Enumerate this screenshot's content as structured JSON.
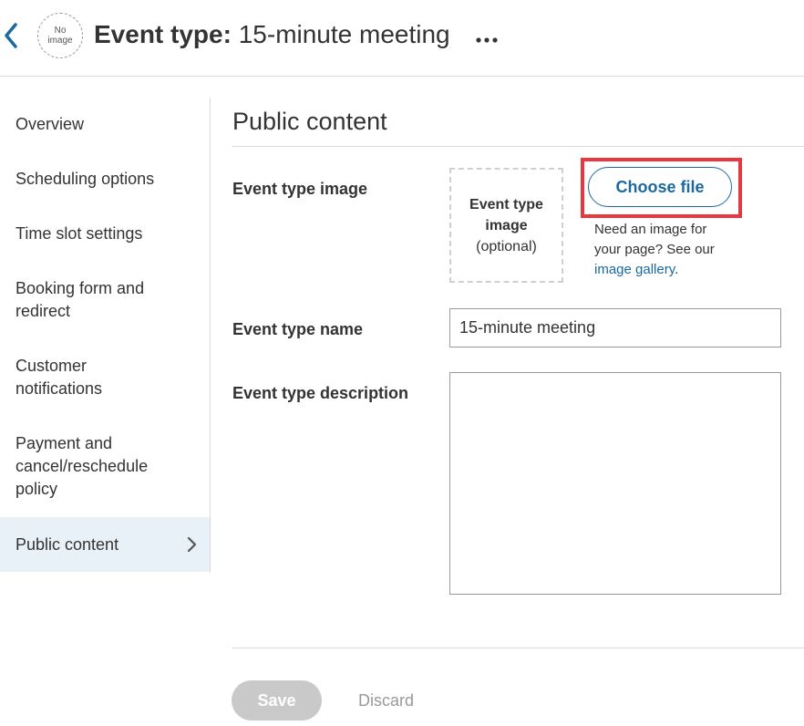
{
  "header": {
    "avatar_text_line1": "No",
    "avatar_text_line2": "image",
    "title_label": "Event type:",
    "title_value": "15-minute meeting"
  },
  "sidebar": {
    "items": [
      {
        "label": "Overview"
      },
      {
        "label": "Scheduling options"
      },
      {
        "label": "Time slot settings"
      },
      {
        "label": "Booking form and redirect"
      },
      {
        "label": "Customer notifications"
      },
      {
        "label": "Payment and cancel/reschedule policy"
      },
      {
        "label": "Public content",
        "active": true
      }
    ]
  },
  "main": {
    "section_title": "Public content",
    "image_field": {
      "label": "Event type image",
      "placeholder_line1": "Event type",
      "placeholder_line2": "image",
      "placeholder_line3": "(optional)",
      "choose_button": "Choose file",
      "help_text": "Need an image for your page? See our ",
      "help_link": "image gallery",
      "help_end": "."
    },
    "name_field": {
      "label": "Event type name",
      "value": "15-minute meeting"
    },
    "description_field": {
      "label": "Event type description",
      "value": ""
    }
  },
  "footer": {
    "save_label": "Save",
    "discard_label": "Discard"
  },
  "colors": {
    "accent": "#1a6aa0",
    "highlight": "#e8383d",
    "active_bg": "#e8f1f8"
  },
  "icons": {
    "back": "chevron-left-icon",
    "more": "more-horizontal-icon",
    "active_item": "chevron-right-icon"
  }
}
